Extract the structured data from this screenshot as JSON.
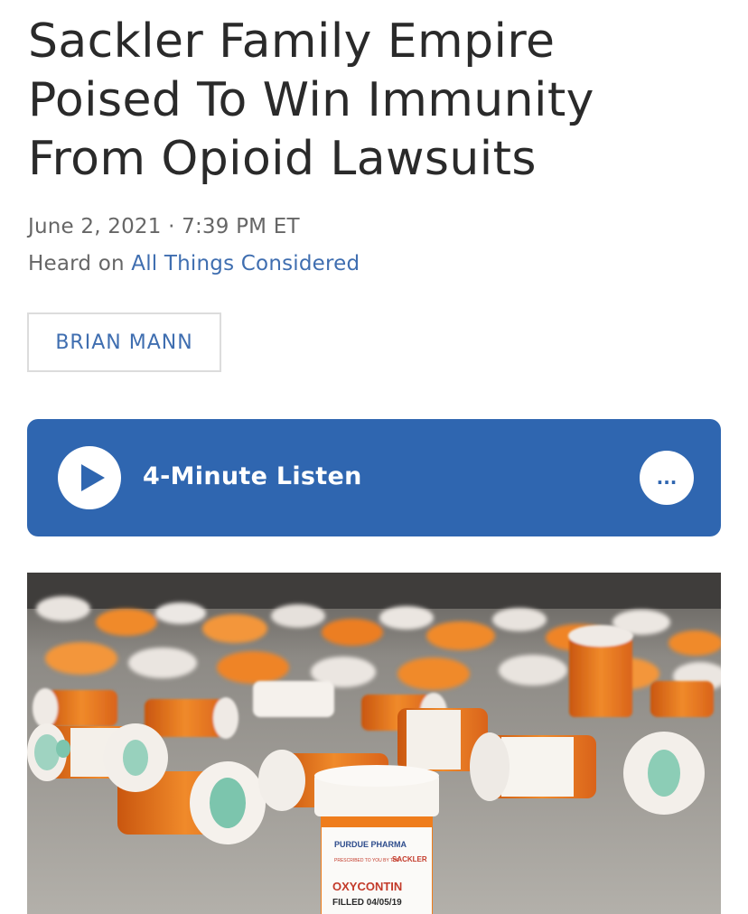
{
  "article": {
    "headline": "Sackler Family Empire Poised To Win Immunity From Opioid Lawsuits",
    "dateline": "June 2, 2021 · 7:39 PM ET",
    "heard_on_prefix": "Heard on",
    "heard_on_show": "All Things Considered",
    "byline": "BRIAN MANN"
  },
  "player": {
    "label": "4-Minute Listen",
    "more_label": "...",
    "background": "#2f66b0"
  },
  "photo": {
    "bottle_labels": {
      "brand": "PURDUE PHARMA",
      "promo": "PRESCRIBED TO YOU BY THE",
      "sackler": "SACKLER",
      "drug": "OXYCONTIN",
      "filled": "FILLED 04/05/19"
    }
  },
  "colors": {
    "link": "#3f6eb0",
    "text": "#2a2a2a",
    "meta": "#666666",
    "bottle_orange": "#e8731e"
  },
  "icons": {
    "play": "play-icon",
    "more": "more-icon"
  }
}
